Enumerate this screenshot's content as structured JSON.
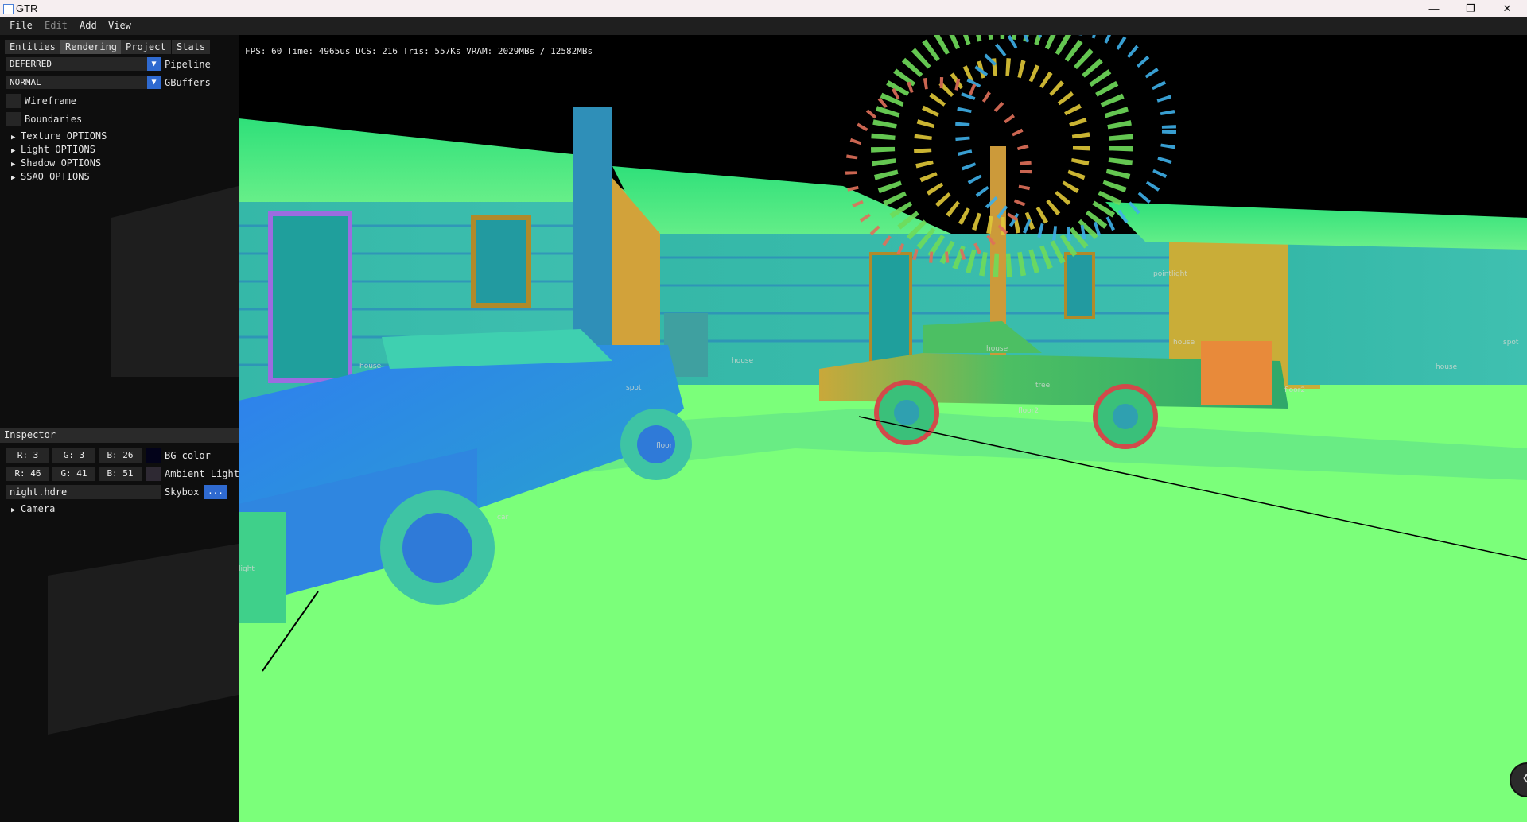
{
  "window": {
    "title": "GTR",
    "controls": {
      "minimize": "—",
      "maximize": "❐",
      "close": "✕"
    }
  },
  "menu": {
    "file": "File",
    "edit": "Edit",
    "add": "Add",
    "view": "View"
  },
  "tabs": [
    {
      "label": "Entities"
    },
    {
      "label": "Rendering",
      "active": true
    },
    {
      "label": "Project"
    },
    {
      "label": "Stats"
    }
  ],
  "rendering": {
    "pipeline_value": "DEFERRED",
    "pipeline_label": "Pipeline",
    "gbuffers_value": "NORMAL",
    "gbuffers_label": "GBuffers",
    "wireframe_label": "Wireframe",
    "boundaries_label": "Boundaries",
    "sections": [
      "Texture OPTIONS",
      "Light OPTIONS",
      "Shadow OPTIONS",
      "SSAO OPTIONS"
    ]
  },
  "inspector": {
    "title": "Inspector",
    "bg_color": {
      "r": "R:  3",
      "g": "G:  3",
      "b": "B: 26",
      "label": "BG color",
      "swatch": "#03031a"
    },
    "ambient": {
      "r": "R: 46",
      "g": "G: 41",
      "b": "B: 51",
      "label": "Ambient Light",
      "swatch": "#2e2933"
    },
    "skybox": {
      "value": "night.hdre",
      "label": "Skybox",
      "button": "..."
    },
    "camera_label": "Camera"
  },
  "viewport": {
    "stats": "FPS: 60 Time: 4965us DCS: 216 Tris: 557Ks  VRAM: 2029MBs / 12582MBs",
    "tags": [
      "house",
      "house",
      "house",
      "house",
      "tree",
      "floor2",
      "floor2",
      "spot",
      "floor",
      "car",
      "light",
      "pointlight",
      "house",
      "spot"
    ]
  },
  "colors": {
    "accent": "#2f6ad0",
    "panel": "#0e0e0e",
    "ground": "#7bff7a"
  },
  "icons": [
    "app-icon",
    "dropdown-arrow-icon",
    "tree-expand-icon",
    "chevron-left-icon"
  ]
}
